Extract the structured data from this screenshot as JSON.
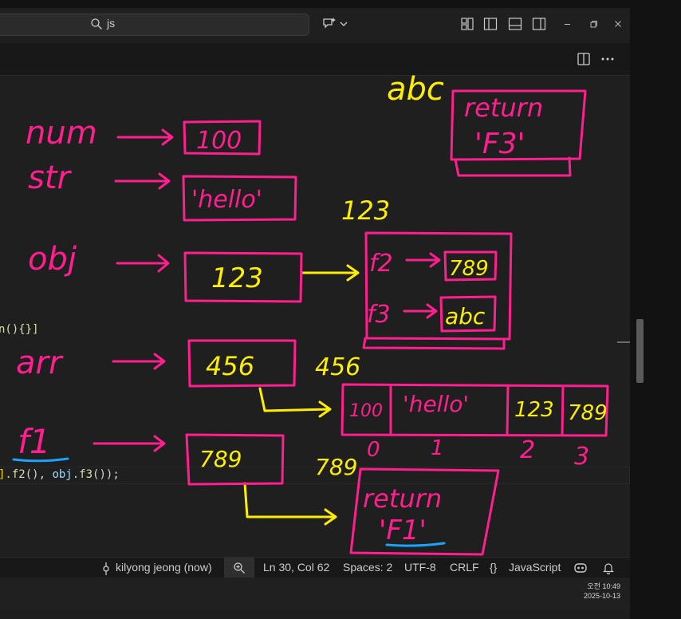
{
  "titlebar": {
    "search_text": "js",
    "icons": [
      "search-icon",
      "copilot-icon",
      "chevron-down-icon",
      "customize-layout-icon",
      "toggle-primary-sidebar-icon",
      "toggle-panel-icon",
      "toggle-secondary-sidebar-icon",
      "minimize-icon",
      "restore-icon",
      "close-icon"
    ]
  },
  "editor": {
    "code_fragment_1": "n(){}]",
    "code_fragment_2a": "].",
    "code_fragment_2b": "f2",
    "code_fragment_2c": "(), ",
    "code_fragment_2d": "obj",
    "code_fragment_2e": ".",
    "code_fragment_2f": "f3",
    "code_fragment_2g": "());"
  },
  "annotations": {
    "labels": {
      "num": "num",
      "str": "str",
      "obj": "obj",
      "arr": "arr",
      "f1": "f1",
      "abc": "abc",
      "addr_123": "123",
      "addr_456": "456",
      "addr_789": "789"
    },
    "boxes": {
      "num_value": "100",
      "str_value": "'hello'",
      "obj_ref": "123",
      "arr_ref": "456",
      "f1_ref": "789",
      "obj_f2": "f2",
      "obj_f2_ref": "789",
      "obj_f3": "f3",
      "obj_f3_ref": "abc",
      "abc_return_kw": "return",
      "abc_return_val": "'F3'",
      "f1_return_kw": "return",
      "f1_return_val": "'F1'"
    },
    "array_cells": [
      "100",
      "'hello'",
      "123",
      "789"
    ],
    "array_indices": [
      "0",
      "1",
      "2",
      "3"
    ],
    "colors": {
      "pink": "#ff1f8e",
      "yellow": "#ffee00",
      "blue": "#1aa3ff"
    }
  },
  "statusbar": {
    "author": "kilyong jeong (now)",
    "position": "Ln 30, Col 62",
    "spaces": "Spaces: 2",
    "encoding": "UTF-8",
    "eol": "CRLF",
    "language_braces": "{}",
    "language": "JavaScript"
  },
  "taskbar": {
    "time": "오전 10:49",
    "date": "2025-10-13"
  }
}
